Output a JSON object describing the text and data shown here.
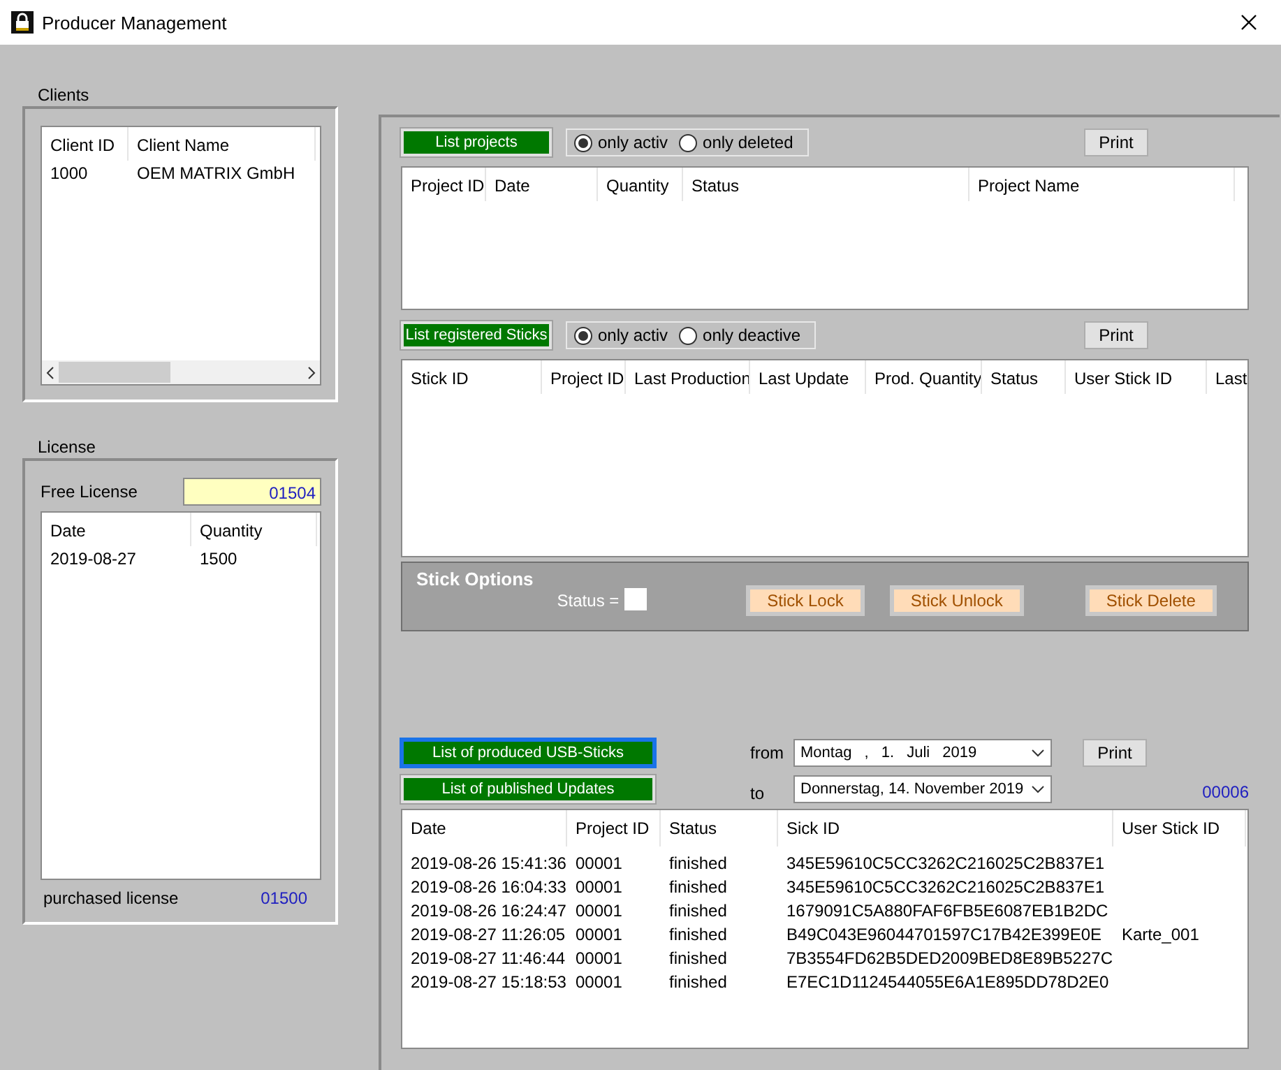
{
  "window": {
    "title": "Producer Management"
  },
  "clients": {
    "label": "Clients",
    "columns": [
      "Client ID",
      "Client Name"
    ],
    "rows": [
      [
        "1000",
        "OEM MATRIX GmbH"
      ]
    ]
  },
  "license": {
    "label": "License",
    "free_label": "Free License",
    "free_value": "01504",
    "columns": [
      "Date",
      "Quantity"
    ],
    "rows": [
      [
        "2019-08-27",
        "1500"
      ]
    ],
    "purchased_label": "purchased license",
    "purchased_value": "01500"
  },
  "projects": {
    "button": "List projects",
    "radios": [
      {
        "label": "only activ",
        "selected": true
      },
      {
        "label": "only deleted",
        "selected": false
      }
    ],
    "print": "Print",
    "columns": [
      "Project ID",
      "Date",
      "Quantity",
      "Status",
      "Project Name"
    ]
  },
  "sticks": {
    "button": "List registered Sticks",
    "radios": [
      {
        "label": "only activ",
        "selected": true
      },
      {
        "label": "only deactive",
        "selected": false
      }
    ],
    "print": "Print",
    "columns": [
      "Stick ID",
      "Project ID",
      "Last Production",
      "Last Update",
      "Prod. Quantity",
      "Status",
      "User Stick ID",
      "Last"
    ]
  },
  "stick_options": {
    "title": "Stick Options",
    "status_label": "Status =",
    "buttons": [
      "Stick Lock",
      "Stick Unlock",
      "Stick Delete"
    ]
  },
  "produced": {
    "buttons": [
      {
        "label": "List of produced USB-Sticks",
        "selected": true
      },
      {
        "label": "List of published Updates",
        "selected": false
      }
    ],
    "from_label": "from",
    "from_value": "Montag , 1. Juli 2019",
    "to_label": "to",
    "to_value": "Donnerstag, 14. November 2019",
    "print": "Print",
    "count": "00006",
    "columns": [
      "Date",
      "Project ID",
      "Status",
      "Sick ID",
      "User Stick ID"
    ],
    "rows": [
      [
        "2019-08-26 15:41:36",
        "00001",
        "finished",
        "345E59610C5CC3262C216025C2B837E1",
        ""
      ],
      [
        "2019-08-26 16:04:33",
        "00001",
        "finished",
        "345E59610C5CC3262C216025C2B837E1",
        ""
      ],
      [
        "2019-08-26 16:24:47",
        "00001",
        "finished",
        "1679091C5A880FAF6FB5E6087EB1B2DC",
        ""
      ],
      [
        "2019-08-27 11:26:05",
        "00001",
        "finished",
        "B49C043E96044701597C17B42E399E0E",
        "Karte_001"
      ],
      [
        "2019-08-27 11:46:44",
        "00001",
        "finished",
        "7B3554FD62B5DED2009BED8E89B5227C",
        ""
      ],
      [
        "2019-08-27 15:18:53",
        "00001",
        "finished",
        "E7EC1D1124544055E6A1E895DD78D2E0",
        ""
      ]
    ]
  }
}
